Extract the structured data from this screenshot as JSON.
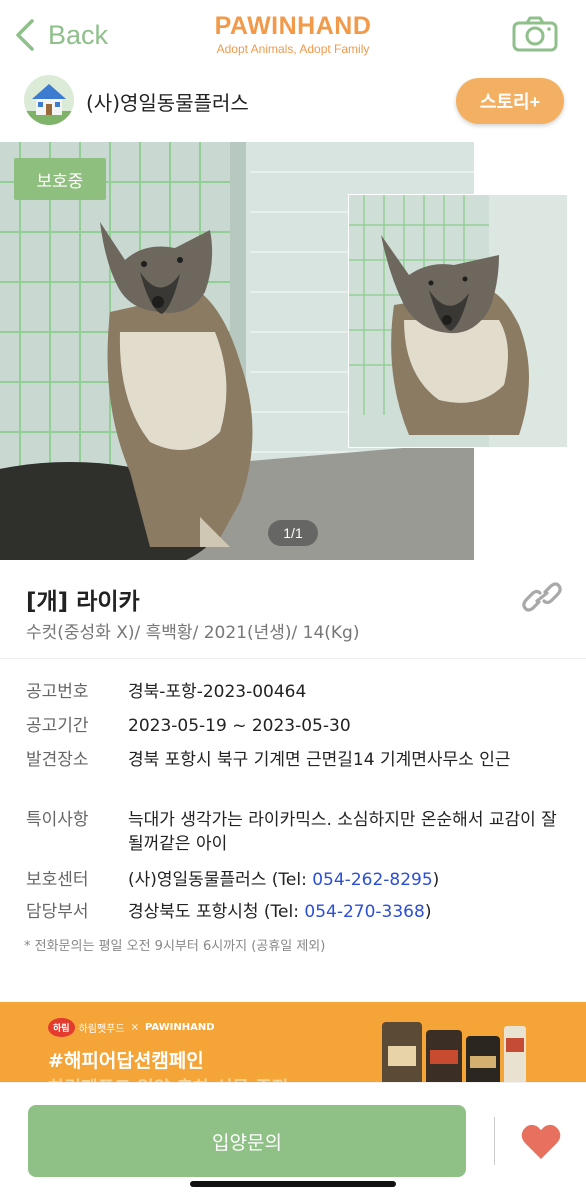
{
  "header": {
    "back_label": "Back",
    "brand_title": "PAWINHAND",
    "brand_subtitle": "Adopt Animals, Adopt Family",
    "back_icon": "chevron-left-icon",
    "camera_icon": "camera-icon"
  },
  "shelter": {
    "name": "(사)영일동물플러스",
    "story_button": "스토리+"
  },
  "photo": {
    "status_badge": "보호중",
    "page_indicator": "1/1"
  },
  "animal": {
    "name": "[개] 라이카",
    "meta": "수컷(중성화 X)/ 흑백황/ 2021(년생)/ 14(Kg)",
    "link_icon": "link-icon"
  },
  "details": {
    "notice_no_label": "공고번호",
    "notice_no_value": "경북-포항-2023-00464",
    "period_label": "공고기간",
    "period_value": "2023-05-19 ~ 2023-05-30",
    "found_label": "발견장소",
    "found_value": "경북 포항시 북구 기계면 근면길14 기계면사무소 인근",
    "special_label": "특이사항",
    "special_value": "늑대가 생각가는 라이카믹스. 소심하지만 온순해서 교감이 잘 될꺼같은 아이",
    "center_label": "보호센터",
    "center_name": "(사)영일동물플러스 (Tel: ",
    "center_tel": "054-262-8295",
    "center_close": ")",
    "dept_label": "담당부서",
    "dept_name": "경상북도 포항시청 (Tel: ",
    "dept_tel": "054-270-3368",
    "dept_close": ")",
    "note": "* 전화문의는 평일 오전 9시부터 6시까지 (공휴일 제외)"
  },
  "banner": {
    "brand_left": "하림",
    "brand_left_sub": "하림펫푸드",
    "cross": "×",
    "brand_right": "PAWINHAND",
    "title": "#해피어답션캠페인",
    "title2": "하림펫푸드 입양 축하 선물 증정"
  },
  "bottom": {
    "adopt_button": "입양문의",
    "heart_icon": "heart-icon"
  },
  "colors": {
    "brand_orange": "#f2994a",
    "accent_green": "#8fc086",
    "tel_blue": "#2b4fd6",
    "heart_red": "#e8705f"
  }
}
